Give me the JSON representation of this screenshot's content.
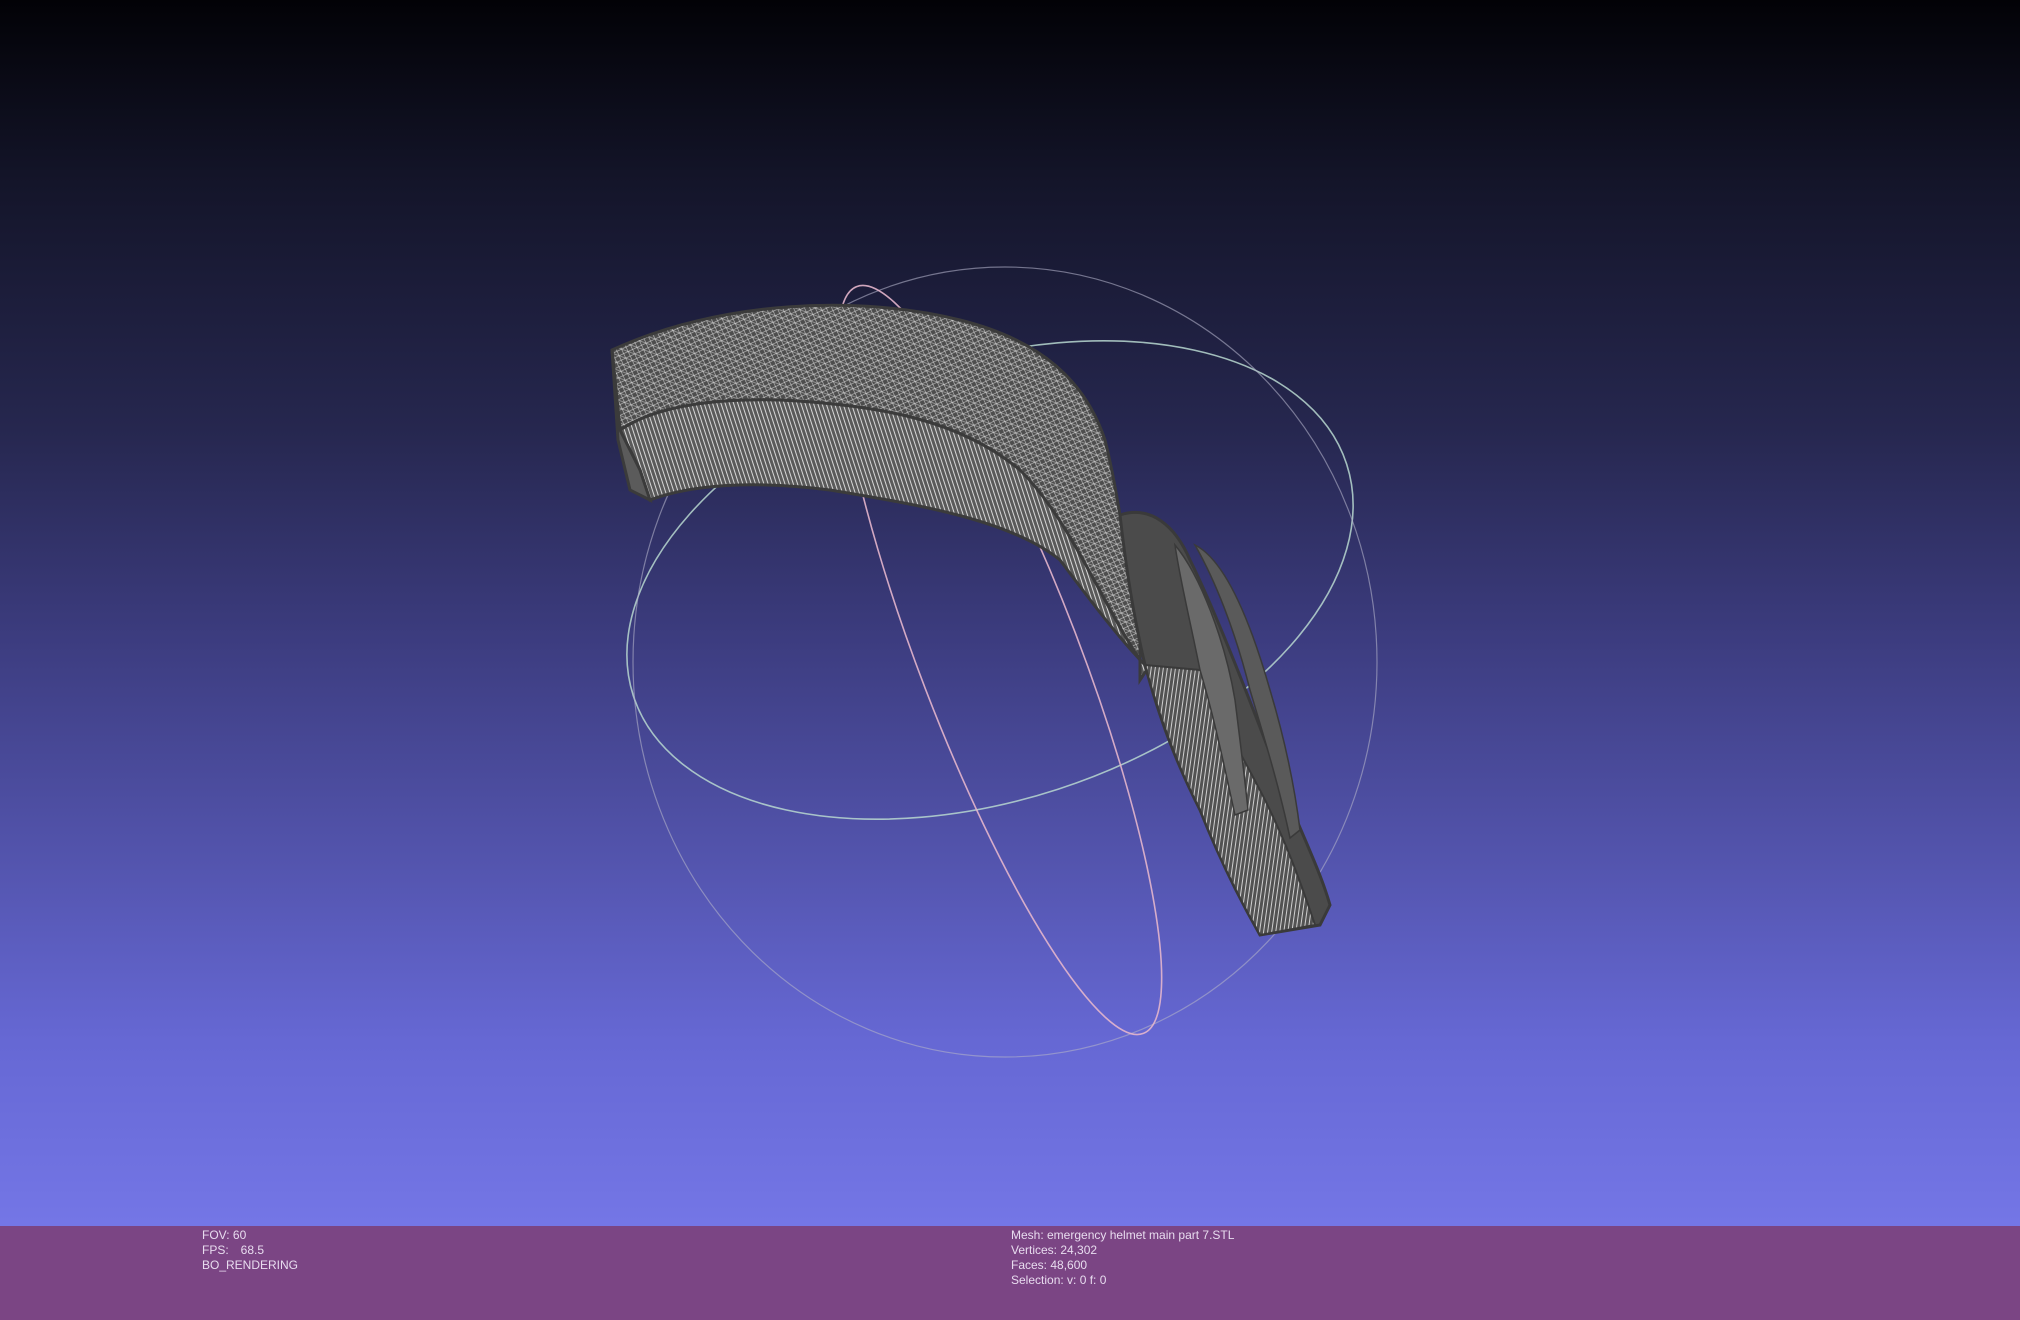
{
  "viewport": {
    "background_top": "#020206",
    "background_bottom": "#7476e6",
    "mesh_color": "#4a4a4a",
    "wire_color": "#d8d8d8",
    "trackball_colors": [
      "#b0d0c8",
      "#e0b0c8",
      "#b0b0c8"
    ]
  },
  "status": {
    "left": {
      "fov_label": "FOV: 60",
      "fps_label": "FPS:",
      "fps_value": "68.5",
      "render_mode": "BO_RENDERING"
    },
    "right": {
      "mesh": "Mesh: emergency helmet main part 7.STL",
      "vertices": "Vertices: 24,302",
      "faces": "Faces: 48,600",
      "selection": "Selection: v: 0 f: 0"
    }
  }
}
